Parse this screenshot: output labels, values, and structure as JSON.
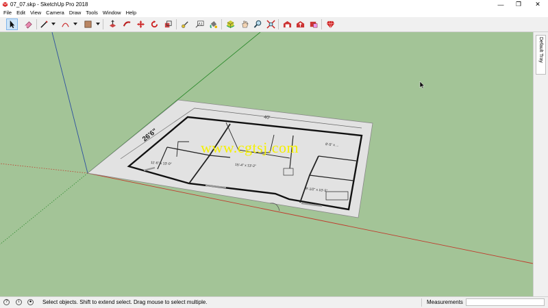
{
  "window": {
    "title": "07_07.skp - SketchUp Pro 2018",
    "minimize_glyph": "—",
    "maximize_glyph": "❐",
    "close_glyph": "✕"
  },
  "menu": [
    "File",
    "Edit",
    "View",
    "Camera",
    "Draw",
    "Tools",
    "Window",
    "Help"
  ],
  "toolbar": {
    "active_tool": "select",
    "tools": [
      {
        "name": "select-icon"
      },
      {
        "name": "eraser-icon"
      },
      {
        "name": "line-icon"
      },
      {
        "name": "arc-icon"
      },
      {
        "name": "rectangle-icon"
      },
      {
        "name": "push-pull-icon"
      },
      {
        "name": "follow-me-icon"
      },
      {
        "name": "move-icon"
      },
      {
        "name": "rotate-icon"
      },
      {
        "name": "scale-icon"
      },
      {
        "name": "tape-measure-icon"
      },
      {
        "name": "text-icon"
      },
      {
        "name": "paint-bucket-icon"
      },
      {
        "name": "orbit-icon"
      },
      {
        "name": "pan-icon"
      },
      {
        "name": "zoom-icon"
      },
      {
        "name": "zoom-extents-icon"
      },
      {
        "name": "warehouse-icon"
      },
      {
        "name": "share-model-icon"
      },
      {
        "name": "extension-warehouse-icon"
      },
      {
        "name": "ruby-icon"
      }
    ]
  },
  "tray": {
    "label": "Default Tray"
  },
  "floorplan": {
    "dimension_top": "40'",
    "dimension_side": "26'6\"",
    "room_left": "11'-6\" x 13'-0\"",
    "room_center": "15'-4\" x 13'-2\"",
    "room_right": "9'-1/2\" x 10'-5\"",
    "room_top_right": "8'-5\" x ..."
  },
  "watermark": "www.cgtsj.com",
  "status": {
    "message": "Select objects. Shift to extend select. Drag mouse to select multiple.",
    "measurements_label": "Measurements",
    "measurements_value": ""
  },
  "colors": {
    "ground": "#a3c497",
    "toolbar_bg": "#f0f0f0",
    "watermark": "#f5f000",
    "axis_red": "#c0392b",
    "axis_green": "#2e8b2e",
    "axis_blue": "#2c4fa0"
  }
}
